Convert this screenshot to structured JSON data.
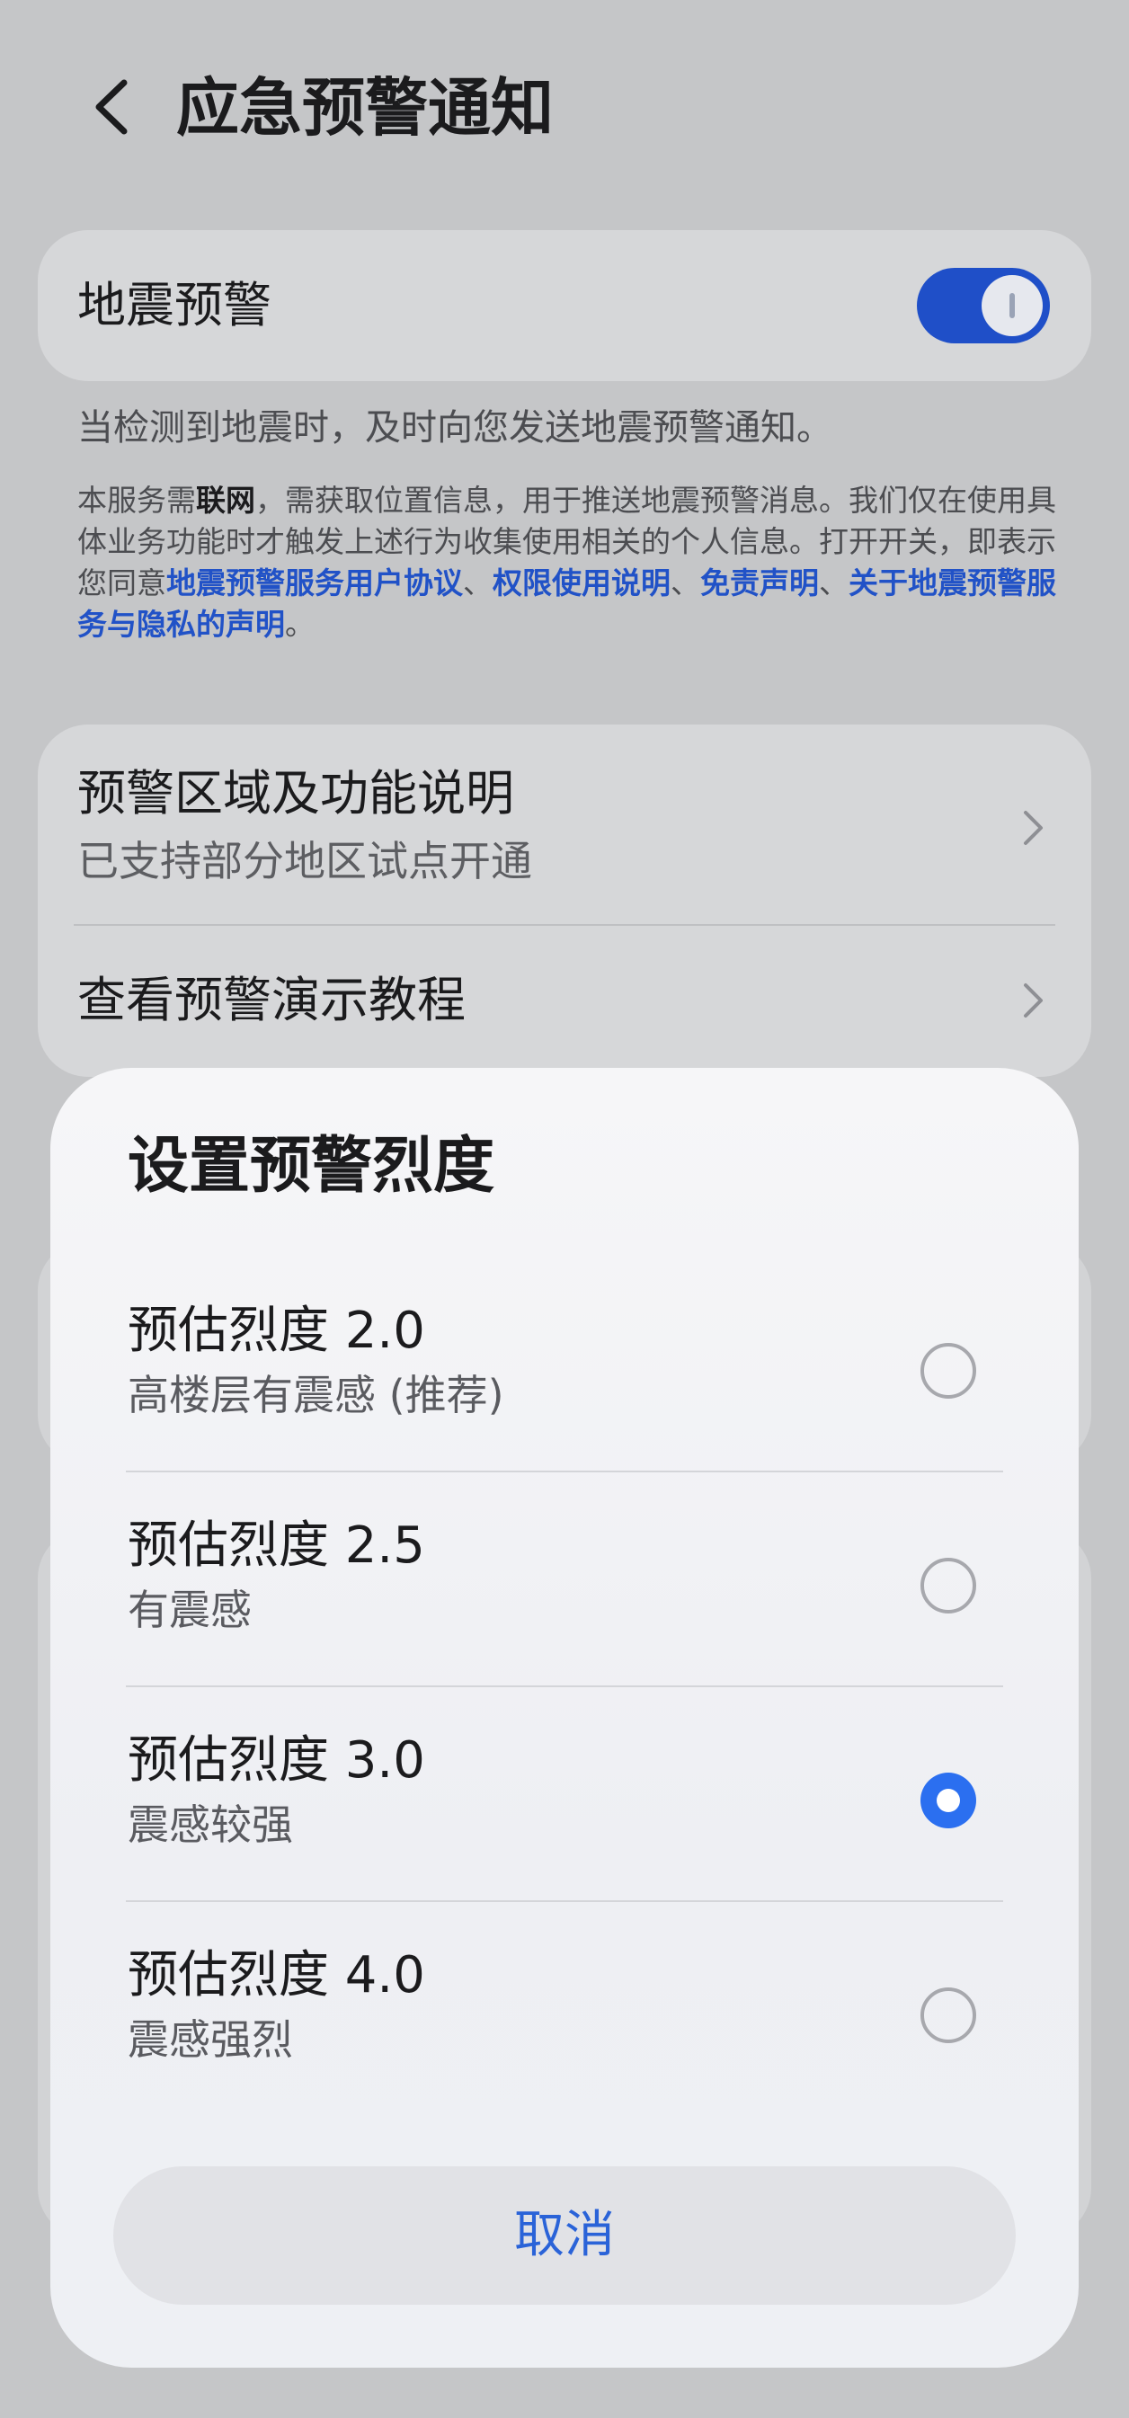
{
  "header": {
    "title": "应急预警通知"
  },
  "earthquake_card": {
    "label": "地震预警",
    "toggle_on": true,
    "accent_color": "#1f4fc8"
  },
  "description": {
    "main": "当检测到地震时，及时向您发送地震预警通知。",
    "legal": {
      "p1": "本服务需",
      "p1_bold": "联网",
      "p2": "，需获取位置信息，用于推送地震预警消息。我们仅在使用具体业务功能时才触发上述行为收集使用相关的个人信息。打开开关，即表示您同意",
      "link1": "地震预警服务用户协议",
      "sep1": "、",
      "link2": "权限使用说明",
      "sep2": "、",
      "link3": "免责声明",
      "sep3": "、",
      "link4": "关于地震预警服务与隐私的声明",
      "end": "。"
    }
  },
  "menu": {
    "items": [
      {
        "title": "预警区域及功能说明",
        "subtitle": "已支持部分地区试点开通"
      },
      {
        "title": "查看预警演示教程"
      }
    ]
  },
  "sheet": {
    "title": "设置预警烈度",
    "options": [
      {
        "label": "预估烈度 2.0",
        "desc": "高楼层有震感 (推荐)",
        "selected": false
      },
      {
        "label": "预估烈度 2.5",
        "desc": "有震感",
        "selected": false
      },
      {
        "label": "预估烈度 3.0",
        "desc": "震感较强",
        "selected": true
      },
      {
        "label": "预估烈度 4.0",
        "desc": "震感强烈",
        "selected": false
      }
    ],
    "cancel_label": "取消",
    "radio_color": "#2b6ff0"
  }
}
